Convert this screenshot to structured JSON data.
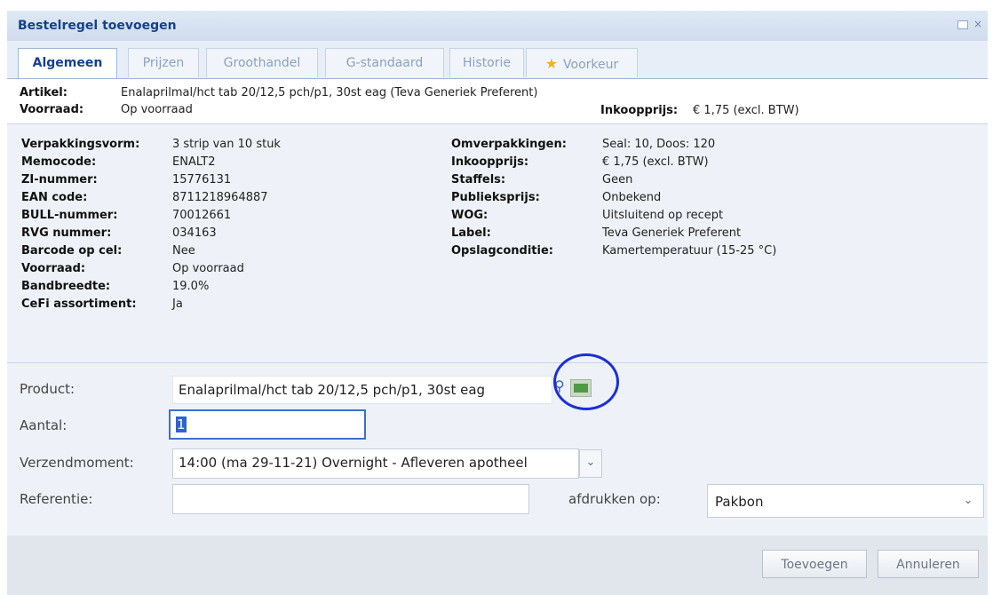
{
  "dialog": {
    "title": "Bestelregel toevoegen",
    "close_glyph": "×"
  },
  "tabs": [
    {
      "label": "Algemeen",
      "active": true
    },
    {
      "label": "Prijzen"
    },
    {
      "label": "Groothandel"
    },
    {
      "label": "G-standaard"
    },
    {
      "label": "Historie"
    },
    {
      "label": "Voorkeur",
      "icon": "star-icon"
    }
  ],
  "header": {
    "artikel_label": "Artikel:",
    "artikel_value": "Enalaprilmal/hct tab 20/12,5 pch/p1, 30st eag (Teva Generiek Preferent)",
    "voorraad_label": "Voorraad:",
    "voorraad_value": "Op voorraad",
    "inkoopprijs_label": "Inkoopprijs:",
    "inkoopprijs_value": "€ 1,75 (excl. BTW)"
  },
  "details_left": [
    {
      "label": "Verpakkingsvorm:",
      "value": "3 strip van 10 stuk"
    },
    {
      "label": "Memocode:",
      "value": "ENALT2"
    },
    {
      "label": "ZI-nummer:",
      "value": "15776131"
    },
    {
      "label": "EAN code:",
      "value": "8711218964887"
    },
    {
      "label": "BULL-nummer:",
      "value": "70012661"
    },
    {
      "label": "RVG nummer:",
      "value": "034163"
    },
    {
      "label": "Barcode op cel:",
      "value": "Nee"
    },
    {
      "label": "Voorraad:",
      "value": "Op voorraad"
    },
    {
      "label": "Bandbreedte:",
      "value": "19.0%"
    },
    {
      "label": "CeFi assortiment:",
      "value": "Ja"
    }
  ],
  "details_right": [
    {
      "label": "Omverpakkingen:",
      "value": "Seal: 10, Doos: 120"
    },
    {
      "label": "Inkoopprijs:",
      "value": "€ 1,75 (excl. BTW)"
    },
    {
      "label": "Staffels:",
      "value": "Geen"
    },
    {
      "label": "Publieksprijs:",
      "value": "Onbekend"
    },
    {
      "label": "WOG:",
      "value": "Uitsluitend op recept"
    },
    {
      "label": "Label:",
      "value": "Teva Generiek Preferent"
    },
    {
      "label": "Opslagconditie:",
      "value": "Kamertemperatuur (15-25 °C)"
    }
  ],
  "form": {
    "product_label": "Product:",
    "product_value": "Enalaprilmal/hct tab 20/12,5 pch/p1, 30st eag",
    "aantal_label": "Aantal:",
    "aantal_value": "1",
    "verzendmoment_label": "Verzendmoment:",
    "verzendmoment_value": "14:00 (ma 29-11-21) Overnight - Afleveren apotheel",
    "referentie_label": "Referentie:",
    "referentie_value": "",
    "afdrukken_label": "afdrukken op:",
    "afdrukken_value": "Pakbon",
    "search_glyph": "⚲",
    "dropdown_glyph": "⌄"
  },
  "buttons": {
    "add": "Toevoegen",
    "cancel": "Annuleren"
  },
  "colors": {
    "title_text": "#15428b",
    "highlight_circle": "#1c2fd6",
    "tab_inactive_text": "#8ba0bd"
  }
}
